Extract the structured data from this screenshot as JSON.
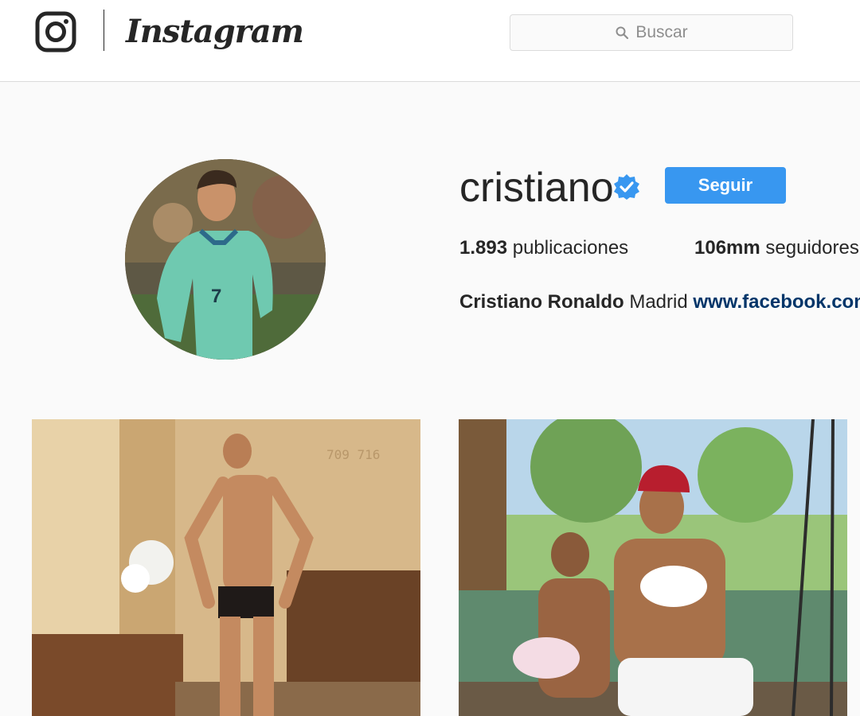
{
  "header": {
    "brand": "Instagram",
    "search_placeholder": "Buscar",
    "icons": [
      "instagram-camera-icon",
      "search-icon"
    ]
  },
  "profile": {
    "username": "cristiano",
    "verified": true,
    "follow_label": "Seguir",
    "stats": {
      "posts_count": "1.893",
      "posts_label": "publicaciones",
      "followers_count": "106mm",
      "followers_label": "seguidores"
    },
    "bio": {
      "full_name": "Cristiano Ronaldo",
      "location": "Madrid",
      "website": "www.facebook.com"
    }
  },
  "posts": [
    {
      "id": "post-1",
      "poster_text": "709 716"
    },
    {
      "id": "post-2"
    }
  ],
  "colors": {
    "accent": "#3897f0",
    "verified": "#3897f0",
    "link": "#003569",
    "text": "#262626",
    "muted": "#8e8e8e",
    "background": "#fafafa"
  }
}
